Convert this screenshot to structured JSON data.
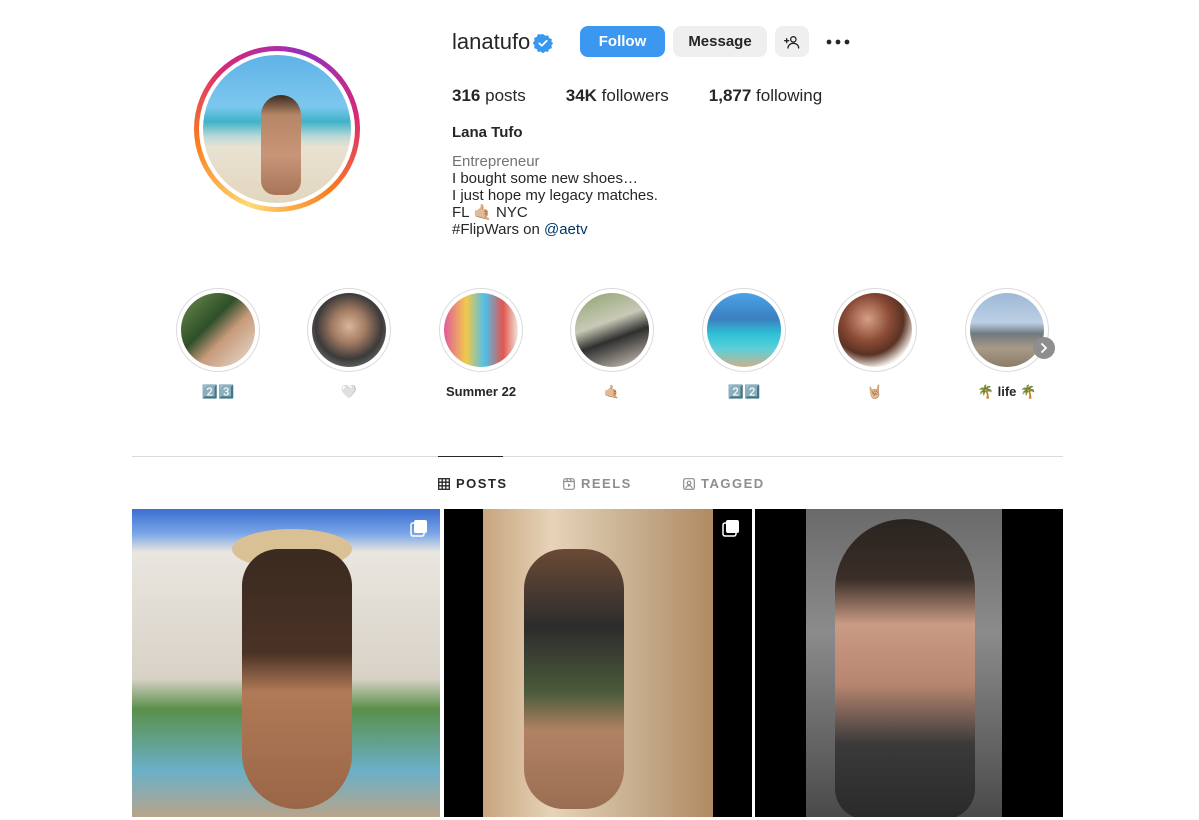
{
  "profile": {
    "username": "lanatufo",
    "full_name": "Lana Tufo",
    "verified": true,
    "stats": {
      "posts_count": "316",
      "posts_label": "posts",
      "followers_count": "34K",
      "followers_label": "followers",
      "following_count": "1,877",
      "following_label": "following"
    },
    "bio": {
      "category": "Entrepreneur",
      "line1": "I bought some new shoes…",
      "line2": "I just hope my legacy matches.",
      "line3_prefix": "FL",
      "line3_emoji": "🤙🏼",
      "line3_suffix": "NYC",
      "line4_prefix": "#FlipWars on",
      "line4_link": "@aetv"
    }
  },
  "actions": {
    "follow_label": "Follow",
    "message_label": "Message",
    "add_user_icon": "add-person-icon",
    "more_icon": "more-horizontal-icon"
  },
  "highlights": [
    {
      "label": "2️⃣3️⃣"
    },
    {
      "label": "🤍"
    },
    {
      "label": "Summer 22"
    },
    {
      "label": "🤙🏼"
    },
    {
      "label": "2️⃣2️⃣"
    },
    {
      "label": "🤘🏼"
    },
    {
      "label": "🌴 life 🌴"
    }
  ],
  "tabs": [
    {
      "label": "POSTS",
      "icon": "grid-icon",
      "active": true
    },
    {
      "label": "REELS",
      "icon": "reels-icon",
      "active": false
    },
    {
      "label": "TAGGED",
      "icon": "tagged-icon",
      "active": false
    }
  ],
  "posts": [
    {
      "type": "carousel"
    },
    {
      "type": "carousel"
    },
    {
      "type": "single"
    }
  ],
  "colors": {
    "accent": "#3b97f0",
    "link": "#00376b",
    "verified": "#3897f0"
  }
}
